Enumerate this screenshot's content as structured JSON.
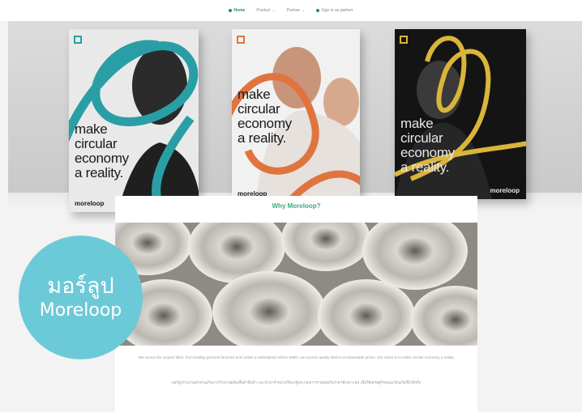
{
  "nav": {
    "items": [
      {
        "label": "Home",
        "active": true
      },
      {
        "label": "Product",
        "active": false
      },
      {
        "label": "Partner",
        "active": false
      },
      {
        "label": "Sign in as partner",
        "active": false
      }
    ]
  },
  "posters": [
    {
      "headline_lines": [
        "make",
        "circular",
        "economy",
        "a reality."
      ],
      "brand": "moreloop",
      "loop_color": "#2a9ea5",
      "text_color": "#1a1a1a"
    },
    {
      "headline_lines": [
        "make",
        "circular",
        "economy",
        "a reality."
      ],
      "brand": "moreloop",
      "loop_color": "#e0743f",
      "text_color": "#1a1a1a"
    },
    {
      "headline_lines": [
        "make",
        "circular",
        "economy",
        "a reality."
      ],
      "brand": "moreloop",
      "loop_color": "#d9b53a",
      "text_color": "#e6e6e6"
    }
  ],
  "card": {
    "title": "Why Moreloop?",
    "paragraph_1": "We source the surplus fabric from leading garment factories and create a marketplace where SMEs can access quality fabrics at reasonable prices. Our vision is to make circular economy a reality.",
    "paragraph_2": "มอร์ลูปรวบรวมผ้าส่วนเกินจากโรงงานผลิตเสื้อผ้าชั้นนำ และนำมาจำหน่ายให้แก่ผู้ประกอบการรายย่อยในราคาที่เหมาะสม เพื่อให้เศรษฐกิจหมุนเวียนเกิดขึ้นได้จริง"
  },
  "badge": {
    "thai": "มอร์ลูป",
    "english": "Moreloop",
    "color": "#6cc9d8"
  },
  "colors": {
    "accent": "#3fa882"
  }
}
